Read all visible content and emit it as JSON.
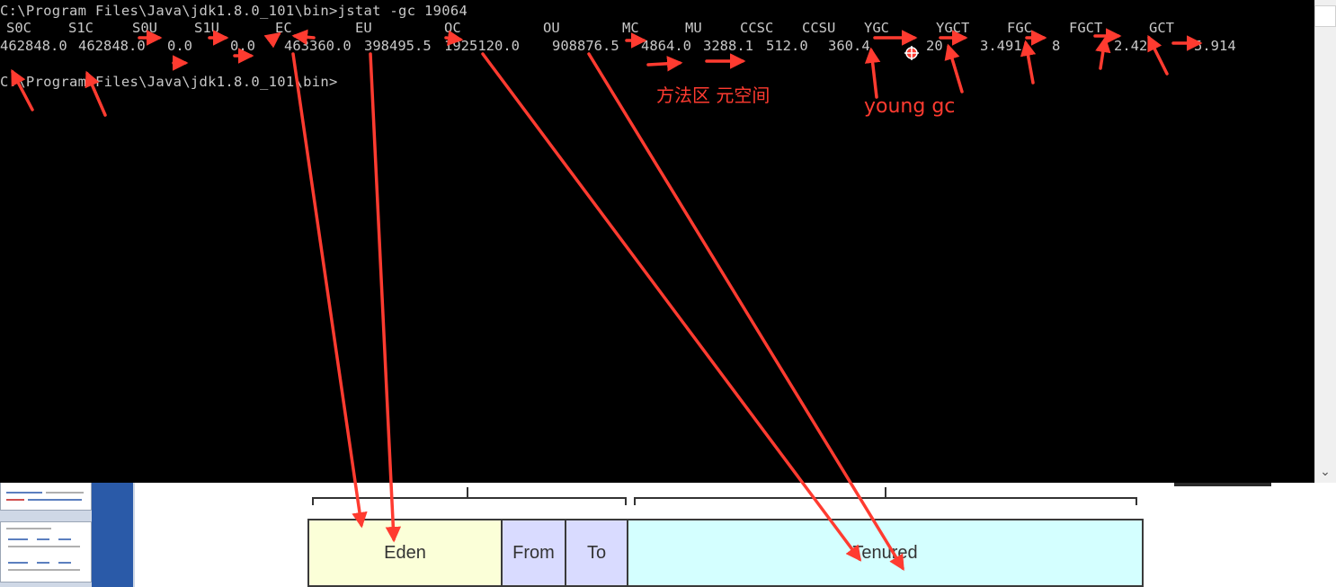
{
  "console": {
    "command_line": "C:\\Program Files\\Java\\jdk1.8.0_101\\bin>jstat -gc 19064",
    "headers": [
      "S0C",
      "S1C",
      "S0U",
      "S1U",
      "EC",
      "EU",
      "OC",
      "OU",
      "MC",
      "MU",
      "CCSC",
      "CCSU",
      "YGC",
      "YGCT",
      "FGC",
      "FGCT",
      "GCT"
    ],
    "values": [
      "462848.0",
      "462848.0",
      "0.0",
      "0.0",
      "463360.0",
      "398495.5",
      "1925120.0",
      "908876.5",
      "4864.0",
      "3288.1",
      "512.0",
      "360.4",
      "20",
      "3.491",
      "8",
      "2.42",
      "5.914"
    ],
    "prompt_line": "C:\\Program Files\\Java\\jdk1.8.0_101\\bin>"
  },
  "annotations": {
    "metaspace_note": "方法区 元空间",
    "young_gc_note": "young gc"
  },
  "diagram": {
    "eden": "Eden",
    "from": "From",
    "to": "To",
    "tenured": "Tenured"
  },
  "scrollbar": {
    "down_arrow": "⌄"
  },
  "colors": {
    "terminal_bg": "#000000",
    "terminal_text": "#c8c8c8",
    "annotation": "#ff3b30"
  }
}
